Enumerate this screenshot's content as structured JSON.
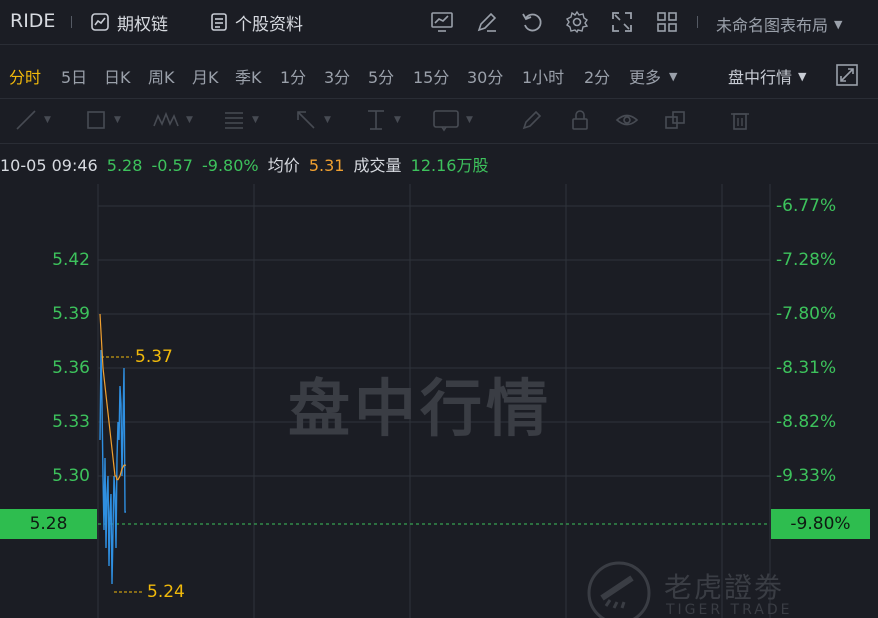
{
  "header": {
    "ticker": "RIDE",
    "options_chain_label": "期权链",
    "stock_info_label": "个股资料",
    "layout_name": "未命名图表布局"
  },
  "periods": [
    "分时",
    "5日",
    "日K",
    "周K",
    "月K",
    "季K",
    "1分",
    "3分",
    "5分",
    "15分",
    "30分",
    "1小时",
    "2分",
    "更多"
  ],
  "active_period": "分时",
  "market_mode": "盘中行情",
  "info": {
    "datetime": "10-05 09:46",
    "price": "5.28",
    "change": "-0.57",
    "change_pct": "-9.80%",
    "avg_label": "均价",
    "avg_value": "5.31",
    "volume_label": "成交量",
    "volume_value": "12.16万股"
  },
  "chart": {
    "left_axis": [
      "5.42",
      "5.39",
      "5.36",
      "5.33",
      "5.30"
    ],
    "right_axis": [
      "-6.77%",
      "-7.28%",
      "-7.80%",
      "-8.31%",
      "-8.82%",
      "-9.33%"
    ],
    "current_price": "5.28",
    "current_pct": "-9.80%",
    "high_marker": "5.37",
    "low_marker": "5.24",
    "watermark": "盘中行情",
    "brand": "老虎證劵",
    "brand_en": "TIGER TRADE"
  },
  "colors": {
    "background": "#1b1d24",
    "up_green": "#3dc25c",
    "price_line": "#2f8fe0",
    "avg_line": "#f0a030",
    "accent": "#f0b90b"
  },
  "chart_data": {
    "type": "line",
    "x": [
      0,
      1,
      2,
      3,
      4,
      5,
      6,
      7,
      8,
      9,
      10,
      11,
      12,
      13,
      14,
      15,
      16,
      17,
      18,
      19,
      20,
      21,
      22,
      23,
      24,
      25,
      26
    ],
    "series": [
      {
        "values": [
          5.32,
          5.37,
          5.34,
          5.3,
          5.27,
          5.31,
          5.26,
          5.29,
          5.3,
          5.25,
          5.28,
          5.29,
          5.24,
          5.27,
          5.3,
          5.29,
          5.26,
          5.31,
          5.33,
          5.32,
          5.35,
          5.34,
          5.3,
          5.33,
          5.36,
          5.28,
          5.28
        ]
      },
      {
        "values": [
          5.39,
          5.38,
          5.37,
          5.36,
          5.355,
          5.35,
          5.345,
          5.34,
          5.335,
          5.33,
          5.325,
          5.32,
          5.315,
          5.31,
          5.305,
          5.3,
          5.3,
          5.298,
          5.298,
          5.299,
          5.3,
          5.302,
          5.304,
          5.305,
          5.306,
          5.306,
          5.306
        ]
      }
    ],
    "ylim": [
      5.22,
      5.45
    ]
  }
}
